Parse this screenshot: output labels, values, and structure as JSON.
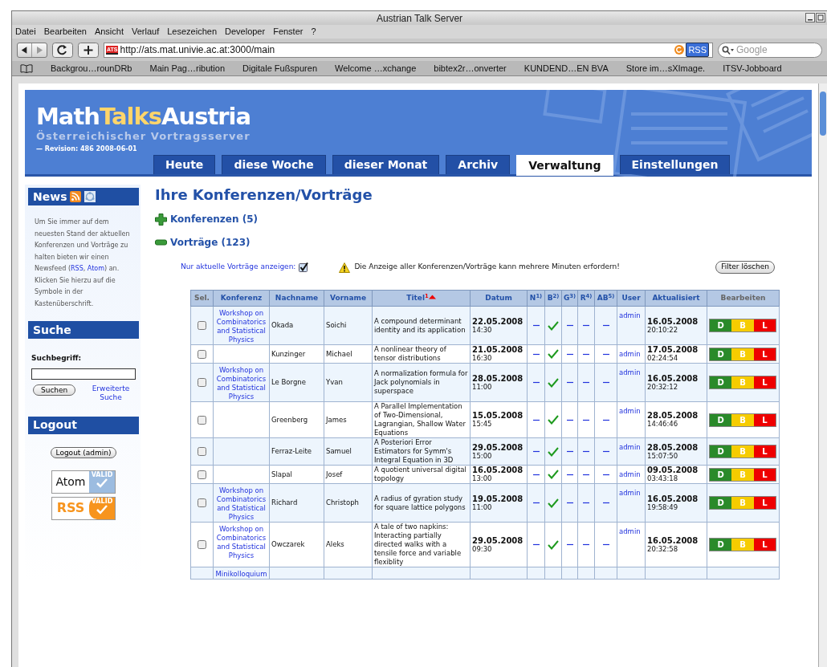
{
  "window": {
    "title": "Austrian Talk Server"
  },
  "menu": [
    "Datei",
    "Bearbeiten",
    "Ansicht",
    "Verlauf",
    "Lesezeichen",
    "Developer",
    "Fenster",
    "?"
  ],
  "toolbar": {
    "url": "http://ats.mat.univie.ac.at:3000/main",
    "favicon": "ATS",
    "rss": "RSS",
    "search_placeholder": "Google"
  },
  "bookmarks": [
    "Backgrou…rounDRb",
    "Main Pag…ribution",
    "Digitale Fußspuren",
    "Welcome …xchange",
    "bibtex2r…onverter",
    "KUNDEND…EN BVA",
    "Store im…sXImage.",
    "ITSV-Jobboard"
  ],
  "header": {
    "logo": [
      {
        "text": "Math",
        "highlight": false
      },
      {
        "text": "Talks",
        "highlight": true
      },
      {
        "text": "Austria",
        "highlight": false
      }
    ],
    "subtitle": "Österreichischer Vortragsserver",
    "revision": "— Revision: 486 2008-06-01"
  },
  "tabs": [
    {
      "label": "Heute",
      "selected": false
    },
    {
      "label": "diese Woche",
      "selected": false
    },
    {
      "label": "dieser Monat",
      "selected": false
    },
    {
      "label": "Archiv",
      "selected": false
    },
    {
      "label": "Verwaltung",
      "selected": true
    },
    {
      "label": "Einstellungen",
      "selected": false
    }
  ],
  "sidebar": {
    "news": {
      "title": "News",
      "text": [
        {
          "kind": "text",
          "text": "Um Sie immer auf dem neuesten Stand der aktuellen Konferenzen und Vorträge zu halten bieten wir einen Newsfeed ("
        },
        {
          "kind": "link",
          "text": "RSS"
        },
        {
          "kind": "text",
          "text": ", "
        },
        {
          "kind": "link",
          "text": "Atom"
        },
        {
          "kind": "text",
          "text": ") an. Klicken Sie hierzu auf die Symbole in der Kastenüberschrift."
        }
      ]
    },
    "search": {
      "title": "Suche",
      "label": "Suchbegriff:",
      "button": "Suchen",
      "advanced": "Erweiterte Suche"
    },
    "logout": {
      "title": "Logout",
      "button": "Logout (admin)",
      "badges": [
        {
          "kind": "atom",
          "name": "Atom",
          "tag": "VALID"
        },
        {
          "kind": "rss",
          "name": "RSS",
          "tag": "VALID"
        }
      ]
    }
  },
  "main": {
    "title": "Ihre Konferenzen/Vorträge",
    "sections": [
      {
        "label": "Konferenzen (5)",
        "expanded": false
      },
      {
        "label": "Vorträge (123)",
        "expanded": true
      }
    ],
    "filter": {
      "label": "Nur aktuelle Vorträge anzeigen:",
      "checked": true,
      "warning": "Die Anzeige aller Konferenzen/Vorträge kann mehrere Minuten erfordern!",
      "button": "Filter löschen"
    },
    "table": {
      "columns": [
        {
          "label": "Sel.",
          "sortable": false
        },
        {
          "label": "Konferenz",
          "sortable": true
        },
        {
          "label": "Nachname",
          "sortable": true
        },
        {
          "label": "Vorname",
          "sortable": true
        },
        {
          "label": "Titel",
          "sortable": true,
          "sort_rank": "1"
        },
        {
          "label": "Datum",
          "sortable": true
        },
        {
          "label": "N$^{1)}$",
          "sortable": true
        },
        {
          "label": "B$^{2)}$",
          "sortable": true
        },
        {
          "label": "G$^{3)}$",
          "sortable": true
        },
        {
          "label": "R$^{4)}$",
          "sortable": true
        },
        {
          "label": "AB$^{5)}$",
          "sortable": true
        },
        {
          "label": "User",
          "sortable": true
        },
        {
          "label": "Aktualisiert",
          "sortable": true
        },
        {
          "label": "Bearbeiten",
          "sortable": false
        }
      ],
      "rows": [
        {
          "checked": false,
          "konferenz": "Workshop on Combinatorics and Statistical Physics",
          "nachname": "Okada",
          "vorname": "Soichi",
          "titel": "A compound determinant identity and its application",
          "datum": "22.05.2008",
          "zeit": "14:30",
          "flags": [
            false,
            true,
            false,
            false,
            false
          ],
          "user": "admin",
          "aktualisiert": "16.05.2008",
          "aktualisiert_zeit": "20:10:22",
          "actions": [
            "D",
            "B",
            "L"
          ]
        },
        {
          "checked": false,
          "nachname": "Kunzinger",
          "vorname": "Michael",
          "titel": "A nonlinear theory of tensor distributions",
          "datum": "21.05.2008",
          "zeit": "16:30",
          "flags": [
            false,
            true,
            false,
            false,
            false
          ],
          "user": "admin",
          "aktualisiert": "17.05.2008",
          "aktualisiert_zeit": "02:24:54",
          "actions": [
            "D",
            "B",
            "L"
          ]
        },
        {
          "checked": false,
          "konferenz": "Workshop on Combinatorics and Statistical Physics",
          "nachname": "Le Borgne",
          "vorname": "Yvan",
          "titel": "A normalization formula for Jack polynomials in superspace",
          "datum": "28.05.2008",
          "zeit": "11:00",
          "flags": [
            false,
            true,
            false,
            false,
            false
          ],
          "user": "admin",
          "aktualisiert": "16.05.2008",
          "aktualisiert_zeit": "20:32:12",
          "actions": [
            "D",
            "B",
            "L"
          ]
        },
        {
          "checked": false,
          "nachname": "Greenberg",
          "vorname": "James",
          "titel": "A Parallel Implementation of Two-Dimensional, Lagrangian, Shallow Water Equations",
          "datum": "15.05.2008",
          "zeit": "15:45",
          "flags": [
            false,
            true,
            false,
            false,
            false
          ],
          "user": "admin",
          "aktualisiert": "28.05.2008",
          "aktualisiert_zeit": "14:46:46",
          "actions": [
            "D",
            "B",
            "L"
          ]
        },
        {
          "checked": false,
          "nachname": "Ferraz-Leite",
          "vorname": "Samuel",
          "titel": "A Posteriori Error Estimators for Symm's Integral Equation in 3D",
          "datum": "29.05.2008",
          "zeit": "15:00",
          "flags": [
            false,
            true,
            false,
            false,
            false
          ],
          "user": "admin",
          "aktualisiert": "28.05.2008",
          "aktualisiert_zeit": "15:07:50",
          "actions": [
            "D",
            "B",
            "L"
          ]
        },
        {
          "checked": false,
          "nachname": "Slapal",
          "vorname": "Josef",
          "titel": "A quotient universal digital topology",
          "datum": "16.05.2008",
          "zeit": "13:00",
          "flags": [
            false,
            true,
            false,
            false,
            false
          ],
          "user": "admin",
          "aktualisiert": "09.05.2008",
          "aktualisiert_zeit": "03:43:18",
          "actions": [
            "D",
            "B",
            "L"
          ]
        },
        {
          "checked": false,
          "konferenz": "Workshop on Combinatorics and Statistical Physics",
          "nachname": "Richard",
          "vorname": "Christoph",
          "titel": "A radius of gyration study for square lattice polygons",
          "datum": "19.05.2008",
          "zeit": "11:00",
          "flags": [
            false,
            true,
            false,
            false,
            false
          ],
          "user": "admin",
          "aktualisiert": "16.05.2008",
          "aktualisiert_zeit": "19:58:49",
          "actions": [
            "D",
            "B",
            "L"
          ]
        },
        {
          "checked": false,
          "konferenz": "Workshop on Combinatorics and Statistical Physics",
          "nachname": "Owczarek",
          "vorname": "Aleks",
          "titel": "A tale of two napkins: Interacting partially directed walks with a tensile force and variable flexiblity",
          "datum": "29.05.2008",
          "zeit": "09:30",
          "flags": [
            false,
            true,
            false,
            false,
            false
          ],
          "user": "admin",
          "aktualisiert": "16.05.2008",
          "aktualisiert_zeit": "20:32:58",
          "actions": [
            "D",
            "B",
            "L"
          ]
        },
        {
          "konferenz": "Minikolloquium"
        }
      ]
    }
  }
}
